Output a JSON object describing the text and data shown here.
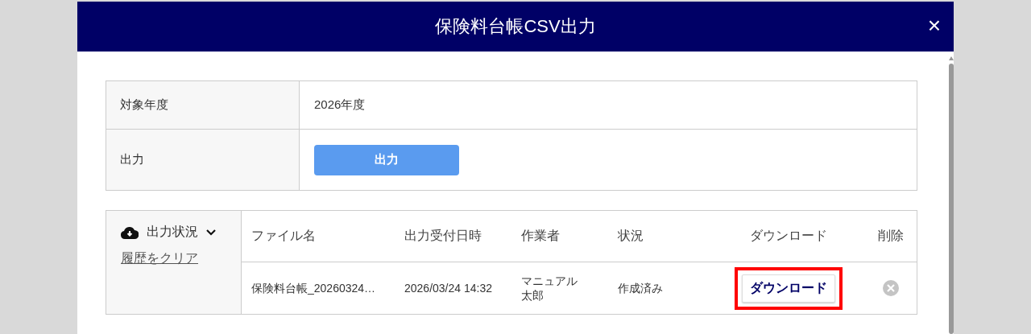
{
  "dialog": {
    "title": "保険料台帳CSV出力",
    "close": "×"
  },
  "form": [
    {
      "kind": "text",
      "label": "対象年度",
      "value": "2026年度"
    },
    {
      "kind": "button",
      "label": "出力",
      "value": "出力"
    }
  ],
  "history": {
    "title": "出力状況",
    "expanded": true,
    "clear_link": "履歴をクリア",
    "columns": [
      "ファイル名",
      "出力受付日時",
      "作業者",
      "状況",
      "ダウンロード",
      "削除"
    ],
    "rows": [
      {
        "file": "保険料台帳_20260324…",
        "date": "2026/03/24 14:32",
        "worker": "マニュアル太郎",
        "status": "作成済み",
        "download": "ダウンロード",
        "highlighted": true
      }
    ]
  }
}
